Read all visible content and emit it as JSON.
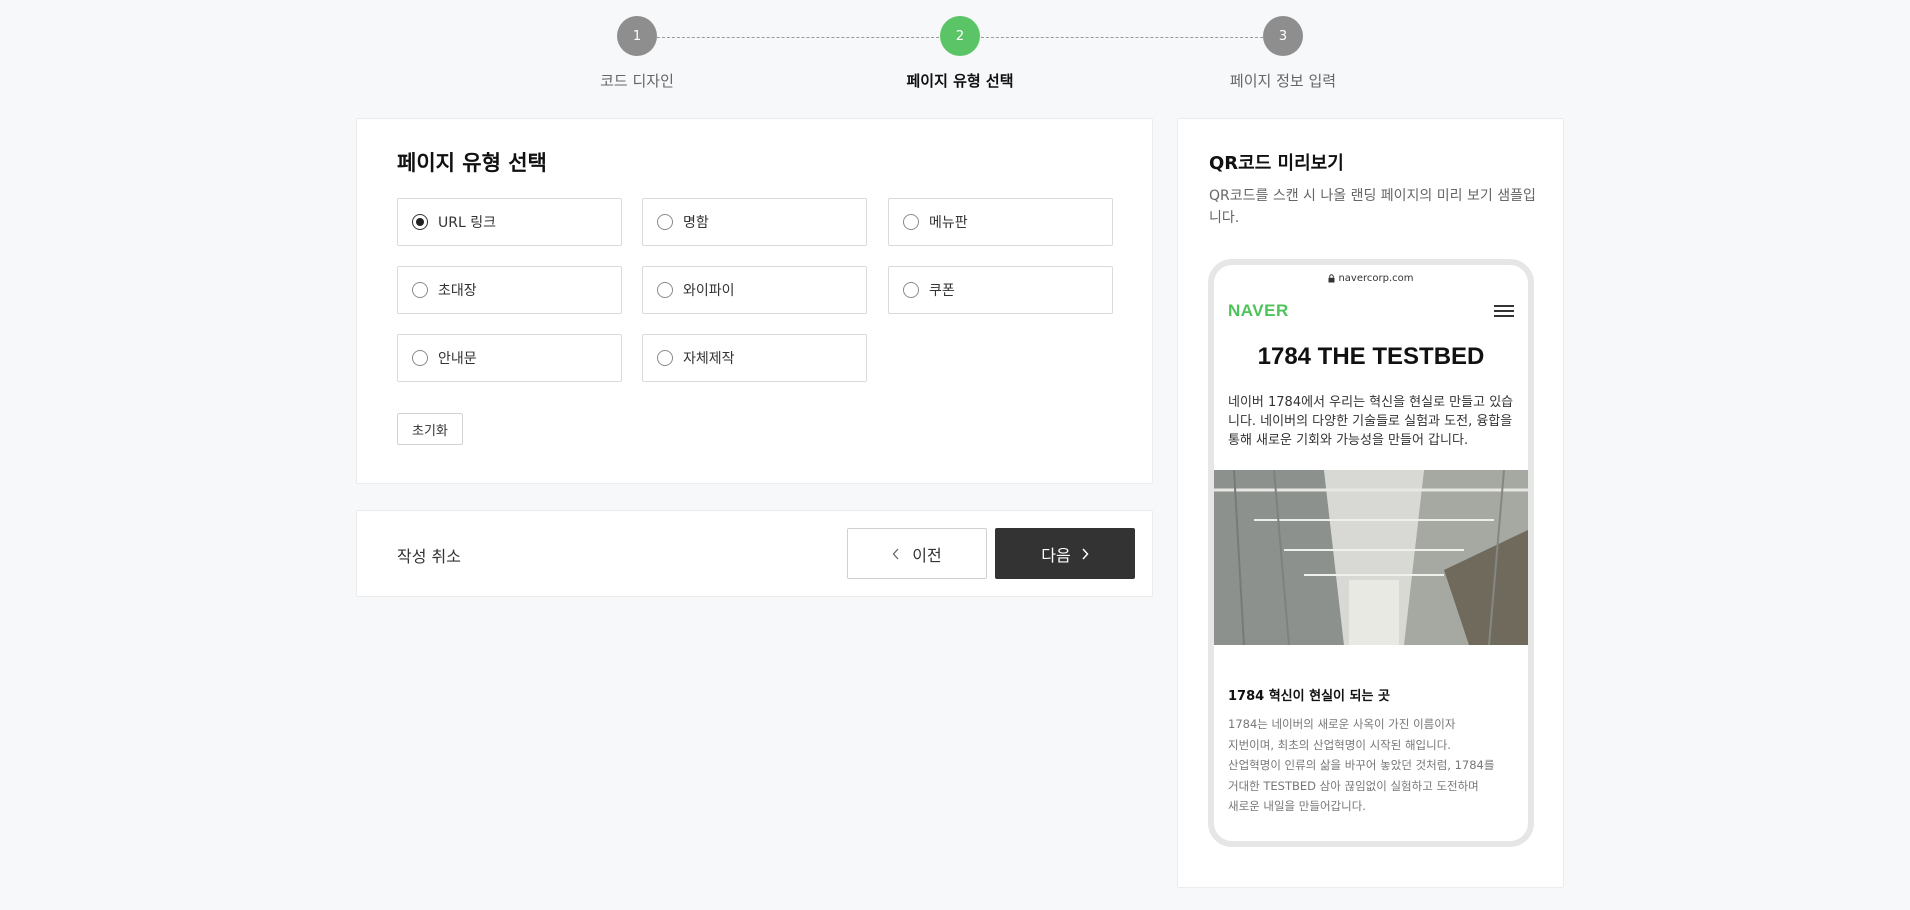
{
  "stepper": {
    "steps": [
      {
        "number": "1",
        "label": "코드 디자인",
        "state": "done"
      },
      {
        "number": "2",
        "label": "페이지 유형 선택",
        "state": "active"
      },
      {
        "number": "3",
        "label": "페이지 정보 입력",
        "state": "pending"
      }
    ]
  },
  "page_type": {
    "title": "페이지 유형 선택",
    "options": [
      {
        "label": "URL 링크",
        "checked": true
      },
      {
        "label": "명함",
        "checked": false
      },
      {
        "label": "메뉴판",
        "checked": false
      },
      {
        "label": "초대장",
        "checked": false
      },
      {
        "label": "와이파이",
        "checked": false
      },
      {
        "label": "쿠폰",
        "checked": false
      },
      {
        "label": "안내문",
        "checked": false
      },
      {
        "label": "자체제작",
        "checked": false
      }
    ],
    "reset_label": "초기화"
  },
  "actions": {
    "cancel_label": "작성 취소",
    "prev_label": "이전",
    "next_label": "다음"
  },
  "preview": {
    "title": "QR코드 미리보기",
    "description": "QR코드를 스캔 시 나올 랜딩 페이지의 미리 보기 샘플입니다.",
    "phone": {
      "url": "navercorp.com",
      "logo": "NAVER",
      "headline": "1784 THE TESTBED",
      "intro": "네이버 1784에서 우리는 혁신을 현실로 만들고 있습니다. 네이버의 다양한 기술들로 실험과 도전, 융합을 통해 새로운 기회와 가능성을 만들어 갑니다.",
      "subtitle": "1784 혁신이 현실이 되는 곳",
      "body_lines": [
        "1784는 네이버의 새로운 사옥이 가진 이름이자",
        "지번이며, 최초의 산업혁명이 시작된 해입니다.",
        "산업혁명이 인류의 삶을 바꾸어 놓았던 것처럼, 1784를",
        "거대한 TESTBED 삼아 끊임없이 실험하고 도전하며",
        "새로운 내일을 만들어갑니다."
      ]
    }
  },
  "colors": {
    "accent": "#5ac466",
    "step_inactive": "#8e8e8e",
    "next_button": "#333333",
    "naver_green": "#4fc35b"
  }
}
